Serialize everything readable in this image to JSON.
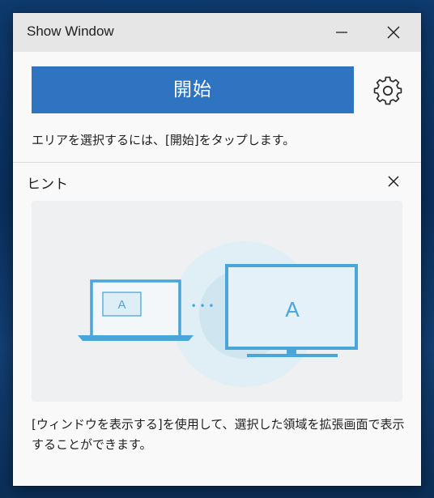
{
  "window": {
    "title": "Show Window"
  },
  "main": {
    "start_label": "開始",
    "instruction": "エリアを選択するには、[開始]をタップします。"
  },
  "hint": {
    "title": "ヒント",
    "illustration": {
      "laptop_screen_letter": "A",
      "monitor_screen_letter": "A",
      "connector": "• • •"
    },
    "description": "[ウィンドウを表示する]を使用して、選択した領域を拡張画面で表示することができます。"
  },
  "colors": {
    "accent": "#2f74c0",
    "illustration_blue": "#4aa6d8"
  },
  "icons": {
    "minimize": "minimize-icon",
    "close": "close-icon",
    "settings": "gear-icon",
    "hint_close": "close-icon"
  }
}
